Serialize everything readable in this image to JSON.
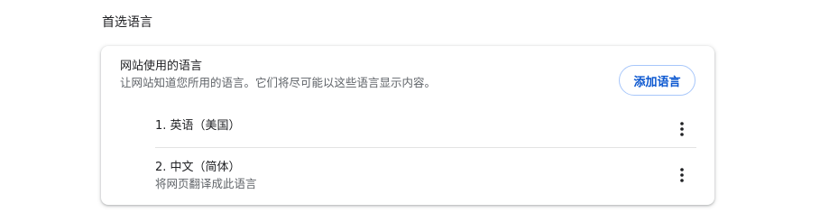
{
  "section": {
    "title": "首选语言"
  },
  "card": {
    "heading": "网站使用的语言",
    "subtext": "让网站知道您所用的语言。它们将尽可能以这些语言显示内容。",
    "add_button_label": "添加语言"
  },
  "languages": [
    {
      "label": "1. 英语（美国）",
      "more_icon": "more-vert-icon"
    },
    {
      "label": "2. 中文（简体）",
      "sublabel": "将网页翻译成此语言",
      "more_icon": "more-vert-icon"
    }
  ],
  "colors": {
    "accent": "#0b57d0",
    "button_border": "#a8c7fa",
    "secondary_text": "#5f6368",
    "divider": "#e3e3e3"
  }
}
